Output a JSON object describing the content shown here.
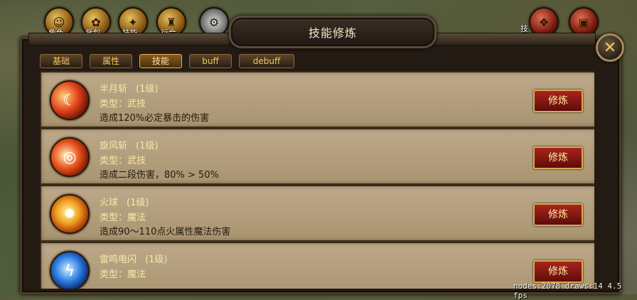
{
  "hud": {
    "left_icons": [
      {
        "label": "角色",
        "icon": "character-icon"
      },
      {
        "label": "背包",
        "icon": "bag-icon"
      },
      {
        "label": "技能",
        "icon": "skills-icon"
      },
      {
        "label": "行会",
        "icon": "guild-icon"
      },
      {
        "label": "",
        "icon": "settings-gear-icon"
      }
    ],
    "right_icons": [
      {
        "label": "技",
        "icon": "reward-bag-icon"
      },
      {
        "label": "",
        "icon": "treasure-chest-icon"
      }
    ]
  },
  "window": {
    "title": "技能修炼",
    "close_symbol": "✕"
  },
  "tabs": [
    {
      "label": "基础",
      "active": false
    },
    {
      "label": "属性",
      "active": false
    },
    {
      "label": "技能",
      "active": true
    },
    {
      "label": "buff",
      "active": false
    },
    {
      "label": "debuff",
      "active": false
    }
  ],
  "skills": [
    {
      "name": "半月斩",
      "level": "(1级)",
      "type": "类型：武技",
      "desc": "造成120%必定暴击的伤害",
      "button": "修炼",
      "icon": "crescent-slash-icon"
    },
    {
      "name": "旋风斩",
      "level": "(1级)",
      "type": "类型：武技",
      "desc": "造成二段伤害，80% > 50%",
      "button": "修炼",
      "icon": "whirlwind-slash-icon"
    },
    {
      "name": "火球",
      "level": "(1级)",
      "type": "类型：魔法",
      "desc": "造成90～110点火属性魔法伤害",
      "button": "修炼",
      "icon": "fireball-icon"
    },
    {
      "name": "雷鸣电闪",
      "level": "(1级)",
      "type": "类型：魔法",
      "desc": "",
      "button": "修炼",
      "icon": "thunder-lightning-icon"
    }
  ],
  "debug_text": "nodes:2078 draws:14  4.5 fps"
}
